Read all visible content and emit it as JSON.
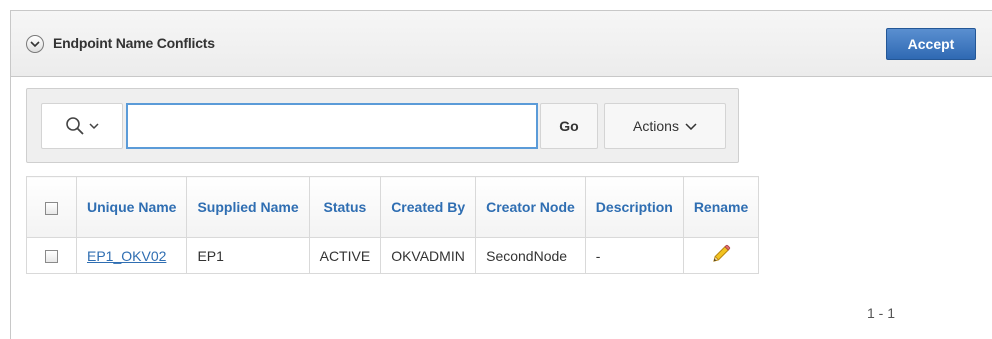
{
  "region": {
    "title": "Endpoint Name Conflicts",
    "accept_label": "Accept"
  },
  "search": {
    "value": "",
    "placeholder": "",
    "go_label": "Go",
    "actions_label": "Actions"
  },
  "table": {
    "columns": [
      "Unique Name",
      "Supplied Name",
      "Status",
      "Created By",
      "Creator Node",
      "Description",
      "Rename"
    ],
    "rows": [
      {
        "unique_name": "EP1_OKV02",
        "supplied_name": "EP1",
        "status": "ACTIVE",
        "created_by": "OKVADMIN",
        "creator_node": "SecondNode",
        "description": "-",
        "rename_icon": "pencil-icon"
      }
    ]
  },
  "pagination": "1 - 1",
  "colors": {
    "accent": "#2f6eb2",
    "accept_button": "#3a74bd",
    "search_focus": "#5b9bd8"
  }
}
